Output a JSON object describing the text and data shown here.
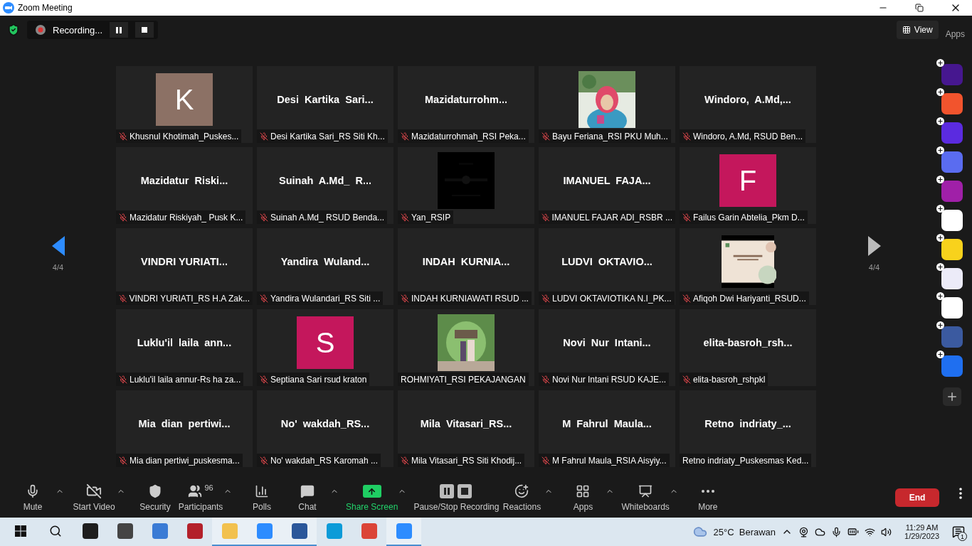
{
  "window": {
    "title": "Zoom Meeting"
  },
  "recording": {
    "label": "Recording..."
  },
  "header_right": {
    "view": "View",
    "apps": "Apps"
  },
  "pager": {
    "left": "4/4",
    "right": "4/4"
  },
  "tiles": [
    {
      "kind": "initial",
      "initial": "K",
      "color": "#8c7165",
      "label": "Khusnul Khotimah_Puskes...",
      "muted": true
    },
    {
      "kind": "name",
      "display_name": "Desi  Kartika  Sari...",
      "label": "Desi Kartika Sari_RS Siti Kh...",
      "muted": true
    },
    {
      "kind": "name",
      "display_name": "Mazidaturrohm...",
      "label": "Mazidaturrohmah_RSI Peka...",
      "muted": true
    },
    {
      "kind": "picture",
      "label": "Bayu Feriana_RSI PKU Muh...",
      "muted": true
    },
    {
      "kind": "name",
      "display_name": "Windoro,  A.Md,...",
      "label": "Windoro, A.Md, RSUD Ben...",
      "muted": true
    },
    {
      "kind": "name",
      "display_name": "Mazidatur  Riski...",
      "label": "Mazidatur Riskiyah_ Pusk K...",
      "muted": true
    },
    {
      "kind": "name",
      "display_name": "Suinah  A.Md_  R...",
      "label": "Suinah A.Md_ RSUD Benda...",
      "muted": true
    },
    {
      "kind": "picture",
      "label": "Yan_RSIP",
      "muted": true
    },
    {
      "kind": "name",
      "display_name": "IMANUEL  FAJA...",
      "label": "IMANUEL FAJAR ADI_RSBR ...",
      "muted": true
    },
    {
      "kind": "initial",
      "initial": "F",
      "color": "#c4175c",
      "label": "Failus Garin Abtelia_Pkm D...",
      "muted": true
    },
    {
      "kind": "name",
      "display_name": "VINDRI YURIATI...",
      "label": "VINDRI YURIATI_RS H.A Zak...",
      "muted": true
    },
    {
      "kind": "name",
      "display_name": "Yandira  Wuland...",
      "label": "Yandira Wulandari_RS Siti ...",
      "muted": true
    },
    {
      "kind": "name",
      "display_name": "INDAH  KURNIA...",
      "label": "INDAH KURNIAWATI RSUD ...",
      "muted": true
    },
    {
      "kind": "name",
      "display_name": "LUDVI  OKTAVIO...",
      "label": "LUDVI OKTAVIOTIKA N.I_PK...",
      "muted": true
    },
    {
      "kind": "picture",
      "label": "Afiqoh Dwi Hariyanti_RSUD...",
      "muted": true
    },
    {
      "kind": "name",
      "display_name": "Luklu'il  laila  ann...",
      "label": "Luklu'il laila annur-Rs ha za...",
      "muted": true
    },
    {
      "kind": "initial",
      "initial": "S",
      "color": "#c4175c",
      "label": "Septiana Sari rsud kraton",
      "muted": true
    },
    {
      "kind": "picture",
      "label": "ROHMIYATI_RSI PEKAJANGAN",
      "muted": false
    },
    {
      "kind": "name",
      "display_name": "Novi  Nur  Intani...",
      "label": "Novi Nur Intani RSUD KAJE...",
      "muted": true
    },
    {
      "kind": "name",
      "display_name": "elita-basroh_rsh...",
      "label": "elita-basroh_rshpkl",
      "muted": true
    },
    {
      "kind": "name",
      "display_name": "Mia  dian  pertiwi...",
      "label": "Mia dian pertiwi_puskesma...",
      "muted": true
    },
    {
      "kind": "name",
      "display_name": "No'  wakdah_RS...",
      "label": "No' wakdah_RS Karomah ...",
      "muted": true
    },
    {
      "kind": "name",
      "display_name": "Mila  Vitasari_RS...",
      "label": "Mila Vitasari_RS Siti Khodij...",
      "muted": true
    },
    {
      "kind": "name",
      "display_name": "M  Fahrul  Maula...",
      "label": "M Fahrul Maula_RSIA Aisyiy...",
      "muted": true
    },
    {
      "kind": "name",
      "display_name": "Retno  indriaty_...",
      "label": "Retno indriaty_Puskesmas Ked...",
      "muted": false
    }
  ],
  "apps": [
    {
      "color": "#46178f"
    },
    {
      "color": "#f2542d"
    },
    {
      "color": "#5b2be0"
    },
    {
      "color": "#5a6cf0"
    },
    {
      "color": "#a020a8"
    },
    {
      "color": "#ffffff"
    },
    {
      "color": "#f8d21c"
    },
    {
      "color": "#ecebf8"
    },
    {
      "color": "#ffffff"
    },
    {
      "color": "#3b5aa0"
    },
    {
      "color": "#1f6ff0"
    }
  ],
  "toolbar": [
    {
      "kind": "mic",
      "label": "Mute",
      "caret": true
    },
    {
      "kind": "video-off",
      "label": "Start Video",
      "caret": true
    },
    {
      "kind": "security",
      "label": "Security",
      "caret": false
    },
    {
      "kind": "participants",
      "label": "Participants",
      "badge": "96",
      "caret": true
    },
    {
      "kind": "polls",
      "label": "Polls",
      "caret": false
    },
    {
      "kind": "chat",
      "label": "Chat",
      "caret": true
    },
    {
      "kind": "share",
      "label": "Share Screen",
      "caret": true
    },
    {
      "kind": "record",
      "label": "Pause/Stop Recording",
      "caret": false
    },
    {
      "kind": "reactions",
      "label": "Reactions",
      "caret": true
    },
    {
      "kind": "apps",
      "label": "Apps",
      "caret": true
    },
    {
      "kind": "whiteboards",
      "label": "Whiteboards",
      "caret": true
    },
    {
      "kind": "more",
      "label": "More",
      "caret": false
    }
  ],
  "end_button": "End",
  "taskbar": {
    "weather": "25°C  Berawan",
    "time": "11:29 AM",
    "date": "1/29/2023",
    "notifications": "1",
    "apps": [
      {
        "color": "#1e1e1e",
        "active": false
      },
      {
        "color": "#444444",
        "active": false
      },
      {
        "color": "#3a7bd5",
        "active": false
      },
      {
        "color": "#b3202a",
        "active": false
      },
      {
        "color": "#f2c14e",
        "active": true
      },
      {
        "color": "#2d8cff",
        "active": true
      },
      {
        "color": "#2b579a",
        "active": true
      },
      {
        "color": "#0c9bd8",
        "active": false
      },
      {
        "color": "#db4437",
        "active": false
      },
      {
        "color": "#2d8cff",
        "active": true
      }
    ]
  }
}
